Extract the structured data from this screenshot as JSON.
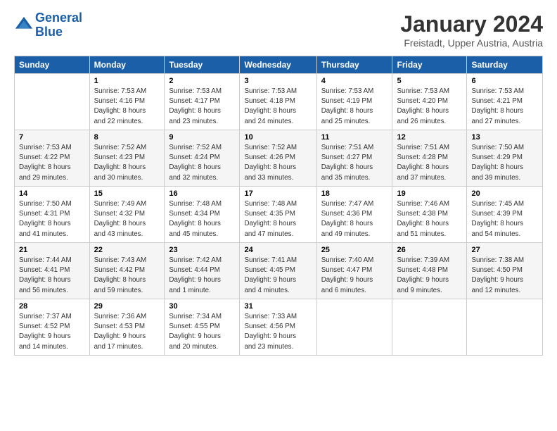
{
  "logo": {
    "line1": "General",
    "line2": "Blue"
  },
  "title": "January 2024",
  "location": "Freistadt, Upper Austria, Austria",
  "days_header": [
    "Sunday",
    "Monday",
    "Tuesday",
    "Wednesday",
    "Thursday",
    "Friday",
    "Saturday"
  ],
  "weeks": [
    [
      {
        "num": "",
        "info": ""
      },
      {
        "num": "1",
        "info": "Sunrise: 7:53 AM\nSunset: 4:16 PM\nDaylight: 8 hours\nand 22 minutes."
      },
      {
        "num": "2",
        "info": "Sunrise: 7:53 AM\nSunset: 4:17 PM\nDaylight: 8 hours\nand 23 minutes."
      },
      {
        "num": "3",
        "info": "Sunrise: 7:53 AM\nSunset: 4:18 PM\nDaylight: 8 hours\nand 24 minutes."
      },
      {
        "num": "4",
        "info": "Sunrise: 7:53 AM\nSunset: 4:19 PM\nDaylight: 8 hours\nand 25 minutes."
      },
      {
        "num": "5",
        "info": "Sunrise: 7:53 AM\nSunset: 4:20 PM\nDaylight: 8 hours\nand 26 minutes."
      },
      {
        "num": "6",
        "info": "Sunrise: 7:53 AM\nSunset: 4:21 PM\nDaylight: 8 hours\nand 27 minutes."
      }
    ],
    [
      {
        "num": "7",
        "info": "Sunrise: 7:53 AM\nSunset: 4:22 PM\nDaylight: 8 hours\nand 29 minutes."
      },
      {
        "num": "8",
        "info": "Sunrise: 7:52 AM\nSunset: 4:23 PM\nDaylight: 8 hours\nand 30 minutes."
      },
      {
        "num": "9",
        "info": "Sunrise: 7:52 AM\nSunset: 4:24 PM\nDaylight: 8 hours\nand 32 minutes."
      },
      {
        "num": "10",
        "info": "Sunrise: 7:52 AM\nSunset: 4:26 PM\nDaylight: 8 hours\nand 33 minutes."
      },
      {
        "num": "11",
        "info": "Sunrise: 7:51 AM\nSunset: 4:27 PM\nDaylight: 8 hours\nand 35 minutes."
      },
      {
        "num": "12",
        "info": "Sunrise: 7:51 AM\nSunset: 4:28 PM\nDaylight: 8 hours\nand 37 minutes."
      },
      {
        "num": "13",
        "info": "Sunrise: 7:50 AM\nSunset: 4:29 PM\nDaylight: 8 hours\nand 39 minutes."
      }
    ],
    [
      {
        "num": "14",
        "info": "Sunrise: 7:50 AM\nSunset: 4:31 PM\nDaylight: 8 hours\nand 41 minutes."
      },
      {
        "num": "15",
        "info": "Sunrise: 7:49 AM\nSunset: 4:32 PM\nDaylight: 8 hours\nand 43 minutes."
      },
      {
        "num": "16",
        "info": "Sunrise: 7:48 AM\nSunset: 4:34 PM\nDaylight: 8 hours\nand 45 minutes."
      },
      {
        "num": "17",
        "info": "Sunrise: 7:48 AM\nSunset: 4:35 PM\nDaylight: 8 hours\nand 47 minutes."
      },
      {
        "num": "18",
        "info": "Sunrise: 7:47 AM\nSunset: 4:36 PM\nDaylight: 8 hours\nand 49 minutes."
      },
      {
        "num": "19",
        "info": "Sunrise: 7:46 AM\nSunset: 4:38 PM\nDaylight: 8 hours\nand 51 minutes."
      },
      {
        "num": "20",
        "info": "Sunrise: 7:45 AM\nSunset: 4:39 PM\nDaylight: 8 hours\nand 54 minutes."
      }
    ],
    [
      {
        "num": "21",
        "info": "Sunrise: 7:44 AM\nSunset: 4:41 PM\nDaylight: 8 hours\nand 56 minutes."
      },
      {
        "num": "22",
        "info": "Sunrise: 7:43 AM\nSunset: 4:42 PM\nDaylight: 8 hours\nand 59 minutes."
      },
      {
        "num": "23",
        "info": "Sunrise: 7:42 AM\nSunset: 4:44 PM\nDaylight: 9 hours\nand 1 minute."
      },
      {
        "num": "24",
        "info": "Sunrise: 7:41 AM\nSunset: 4:45 PM\nDaylight: 9 hours\nand 4 minutes."
      },
      {
        "num": "25",
        "info": "Sunrise: 7:40 AM\nSunset: 4:47 PM\nDaylight: 9 hours\nand 6 minutes."
      },
      {
        "num": "26",
        "info": "Sunrise: 7:39 AM\nSunset: 4:48 PM\nDaylight: 9 hours\nand 9 minutes."
      },
      {
        "num": "27",
        "info": "Sunrise: 7:38 AM\nSunset: 4:50 PM\nDaylight: 9 hours\nand 12 minutes."
      }
    ],
    [
      {
        "num": "28",
        "info": "Sunrise: 7:37 AM\nSunset: 4:52 PM\nDaylight: 9 hours\nand 14 minutes."
      },
      {
        "num": "29",
        "info": "Sunrise: 7:36 AM\nSunset: 4:53 PM\nDaylight: 9 hours\nand 17 minutes."
      },
      {
        "num": "30",
        "info": "Sunrise: 7:34 AM\nSunset: 4:55 PM\nDaylight: 9 hours\nand 20 minutes."
      },
      {
        "num": "31",
        "info": "Sunrise: 7:33 AM\nSunset: 4:56 PM\nDaylight: 9 hours\nand 23 minutes."
      },
      {
        "num": "",
        "info": ""
      },
      {
        "num": "",
        "info": ""
      },
      {
        "num": "",
        "info": ""
      }
    ]
  ]
}
